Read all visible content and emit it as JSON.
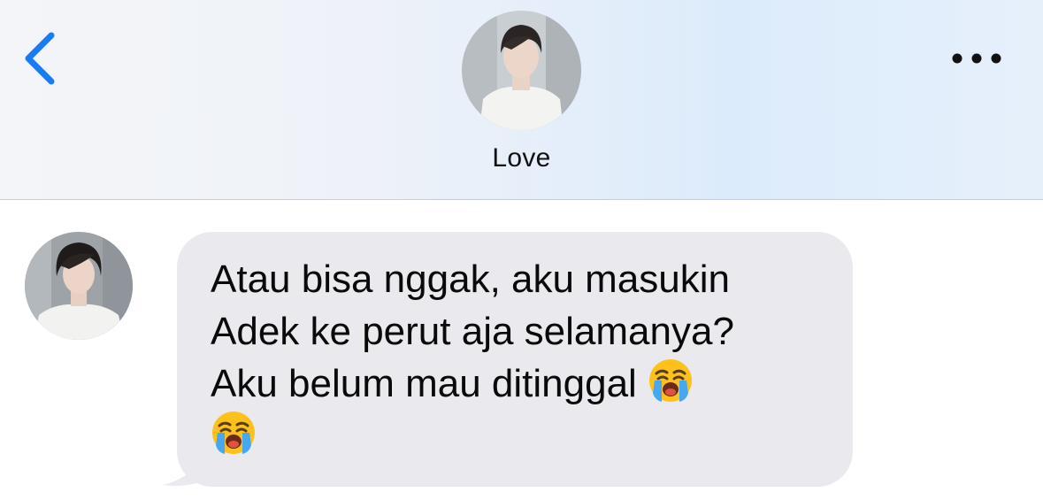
{
  "header": {
    "contact_name": "Love",
    "back_icon": "chevron-left-icon",
    "more_icon": "ellipsis-icon",
    "accent_color": "#1a7cf5"
  },
  "messages": [
    {
      "direction": "incoming",
      "lines": [
        "Atau bisa nggak, aku masukin",
        "Adek ke perut aja selamanya?",
        "Aku belum mau ditinggal "
      ],
      "emoji": "loudly-crying-face",
      "bubble_color": "#e9e9ee"
    }
  ]
}
